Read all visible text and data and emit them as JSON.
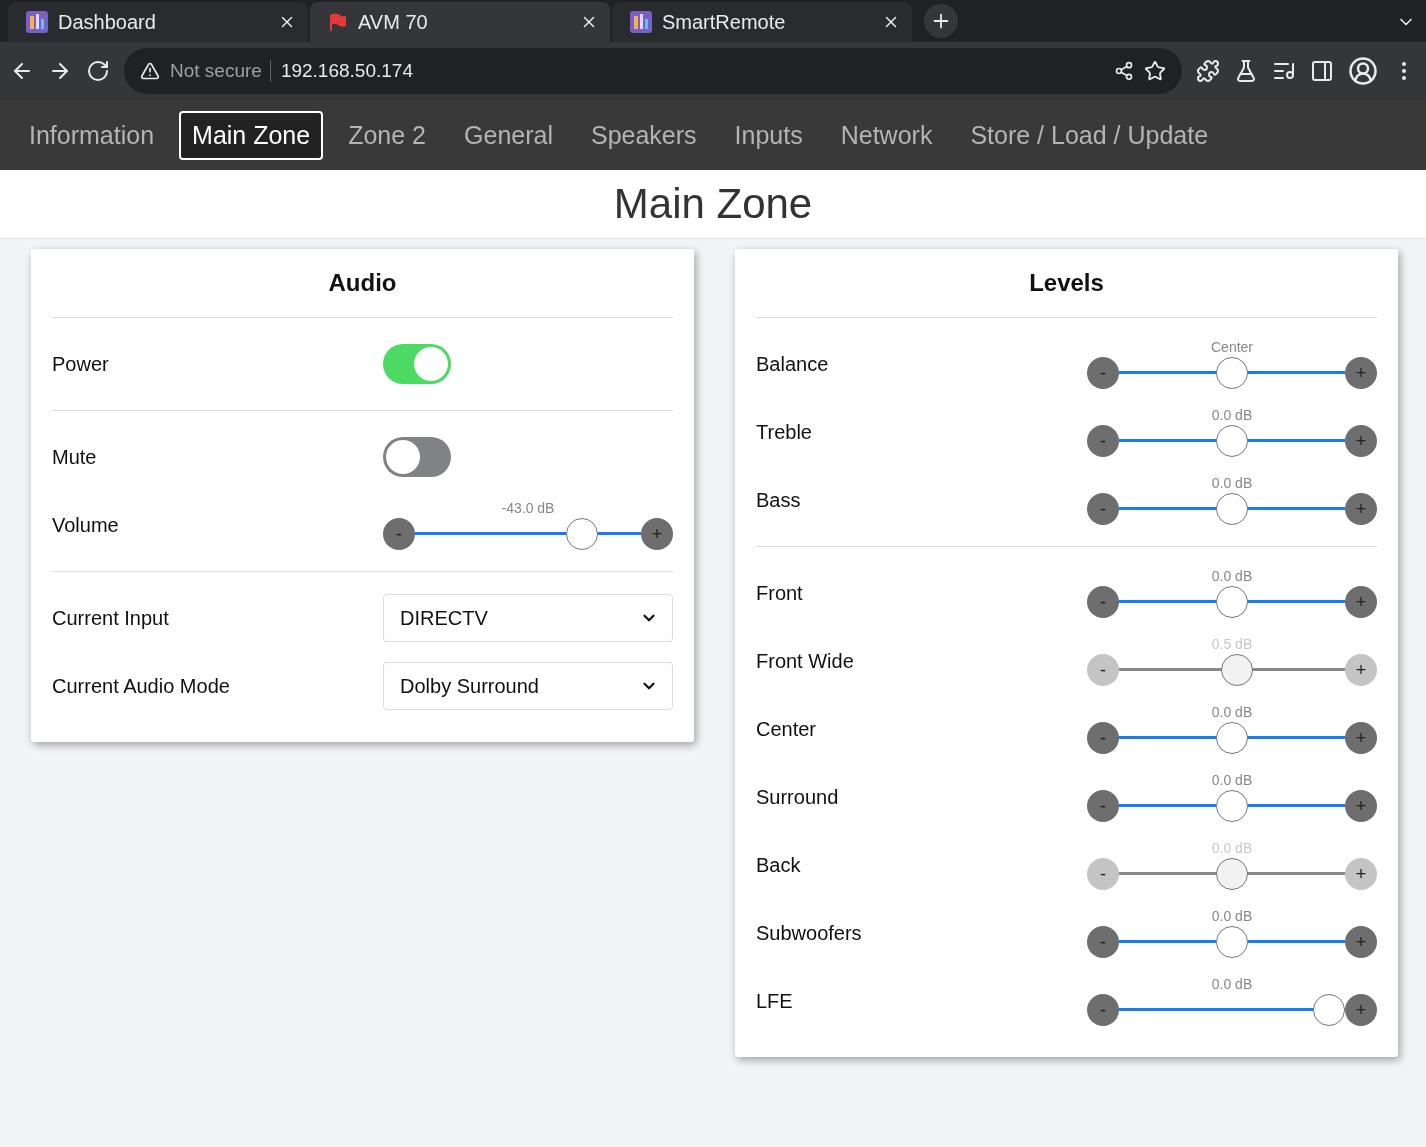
{
  "browser": {
    "tabs": [
      {
        "title": "Dashboard",
        "kind": "grid",
        "selected": false
      },
      {
        "title": "AVM 70",
        "kind": "flag",
        "selected": true
      },
      {
        "title": "SmartRemote",
        "kind": "grid",
        "selected": false
      }
    ],
    "security": "Not secure",
    "url": "192.168.50.174"
  },
  "nav": [
    {
      "label": "Information",
      "selected": false
    },
    {
      "label": "Main Zone",
      "selected": true
    },
    {
      "label": "Zone 2",
      "selected": false
    },
    {
      "label": "General",
      "selected": false
    },
    {
      "label": "Speakers",
      "selected": false
    },
    {
      "label": "Inputs",
      "selected": false
    },
    {
      "label": "Network",
      "selected": false
    },
    {
      "label": "Store / Load / Update",
      "selected": false
    }
  ],
  "page_title": "Main Zone",
  "audio": {
    "title": "Audio",
    "sections": [
      [
        {
          "kind": "toggle",
          "label": "Power",
          "on": true
        }
      ],
      [
        {
          "kind": "toggle",
          "label": "Mute",
          "on": false
        },
        {
          "kind": "slider",
          "label": "Volume",
          "reading": "-43.0 dB",
          "level": 0.74,
          "disabled": false,
          "minus": "-",
          "plus": "+"
        }
      ],
      [
        {
          "kind": "select",
          "label": "Current Input",
          "value": "DIRECTV"
        },
        {
          "kind": "select",
          "label": "Current Audio Mode",
          "value": "Dolby Surround"
        }
      ]
    ]
  },
  "levels": {
    "title": "Levels",
    "sections": [
      [
        {
          "label": "Balance",
          "reading": "Center",
          "level": 0.5,
          "disabled": false,
          "minus": "-",
          "plus": "+"
        },
        {
          "label": "Treble",
          "reading": "0.0 dB",
          "level": 0.5,
          "disabled": false,
          "minus": "-",
          "plus": "+"
        },
        {
          "label": "Bass",
          "reading": "0.0 dB",
          "level": 0.5,
          "disabled": false,
          "minus": "-",
          "plus": "+"
        }
      ],
      [
        {
          "label": "Front",
          "reading": "0.0 dB",
          "level": 0.5,
          "disabled": false,
          "minus": "-",
          "plus": "+"
        },
        {
          "label": "Front Wide",
          "reading": "0.5 dB",
          "level": 0.52,
          "disabled": true,
          "minus": "-",
          "plus": "+"
        },
        {
          "label": "Center",
          "reading": "0.0 dB",
          "level": 0.5,
          "disabled": false,
          "minus": "-",
          "plus": "+"
        },
        {
          "label": "Surround",
          "reading": "0.0 dB",
          "level": 0.5,
          "disabled": false,
          "minus": "-",
          "plus": "+"
        },
        {
          "label": "Back",
          "reading": "0.0 dB",
          "level": 0.5,
          "disabled": true,
          "minus": "-",
          "plus": "+"
        },
        {
          "label": "Subwoofers",
          "reading": "0.0 dB",
          "level": 0.5,
          "disabled": false,
          "minus": "-",
          "plus": "+"
        },
        {
          "label": "LFE",
          "reading": "0.0 dB",
          "level": 0.93,
          "disabled": false,
          "minus": "-",
          "plus": "+"
        }
      ]
    ]
  }
}
